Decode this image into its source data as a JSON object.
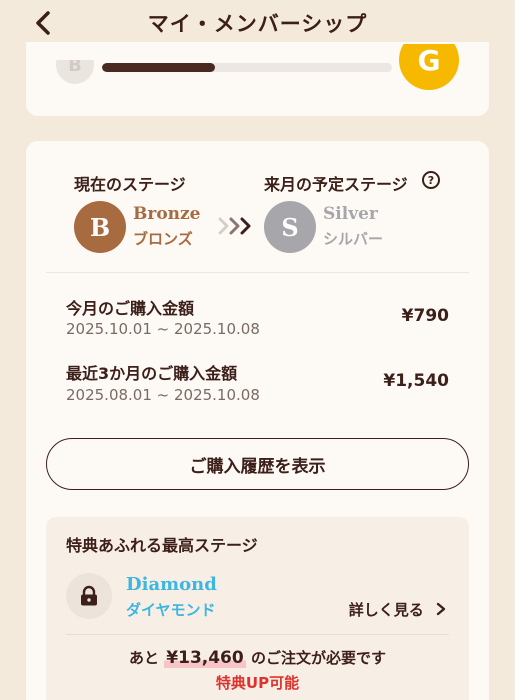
{
  "header": {
    "title": "マイ・メンバーシップ"
  },
  "top_card": {
    "current_badge": "B",
    "next_badge": "G",
    "progress_fraction": 0.39
  },
  "stages": {
    "current_label": "現在のステージ",
    "next_label": "来月の予定ステージ",
    "help_glyph": "?",
    "current": {
      "badge": "B",
      "name_en": "Bronze",
      "name_jp": "ブロンズ",
      "color": "#a86a3f"
    },
    "next": {
      "badge": "S",
      "name_en": "Silver",
      "name_jp": "シルバー",
      "color": "#a7a6aa"
    }
  },
  "amounts": [
    {
      "label": "今月のご購入金額",
      "period": "2025.10.01 ~ 2025.10.08",
      "value": "¥790"
    },
    {
      "label": "最近3か月のご購入金額",
      "period": "2025.08.01 ~ 2025.10.08",
      "value": "¥1,540"
    }
  ],
  "history_button": "ご購入履歴を表示",
  "highest": {
    "title": "特典あふれる最高ステージ",
    "name_en": "Diamond",
    "name_jp": "ダイヤモンド",
    "detail_link": "詳しく見る",
    "need_prefix": "あと ",
    "need_amount": "¥13,460",
    "need_suffix": " のご注文が必要です",
    "benefit_up": "特典UP可能"
  },
  "colors": {
    "background": "#f3eadc",
    "text_dark": "#3d1f19",
    "bronze": "#a86a3f",
    "silver": "#a7a6aa",
    "gold": "#f7b800",
    "diamond": "#3db6e0",
    "alert_red": "#e0322c"
  },
  "icons": {
    "back": "chevron-left-icon",
    "help": "question-circle-icon",
    "arrows": "double-chevron-right-icon",
    "lock": "lock-icon",
    "detail": "chevron-right-icon"
  }
}
